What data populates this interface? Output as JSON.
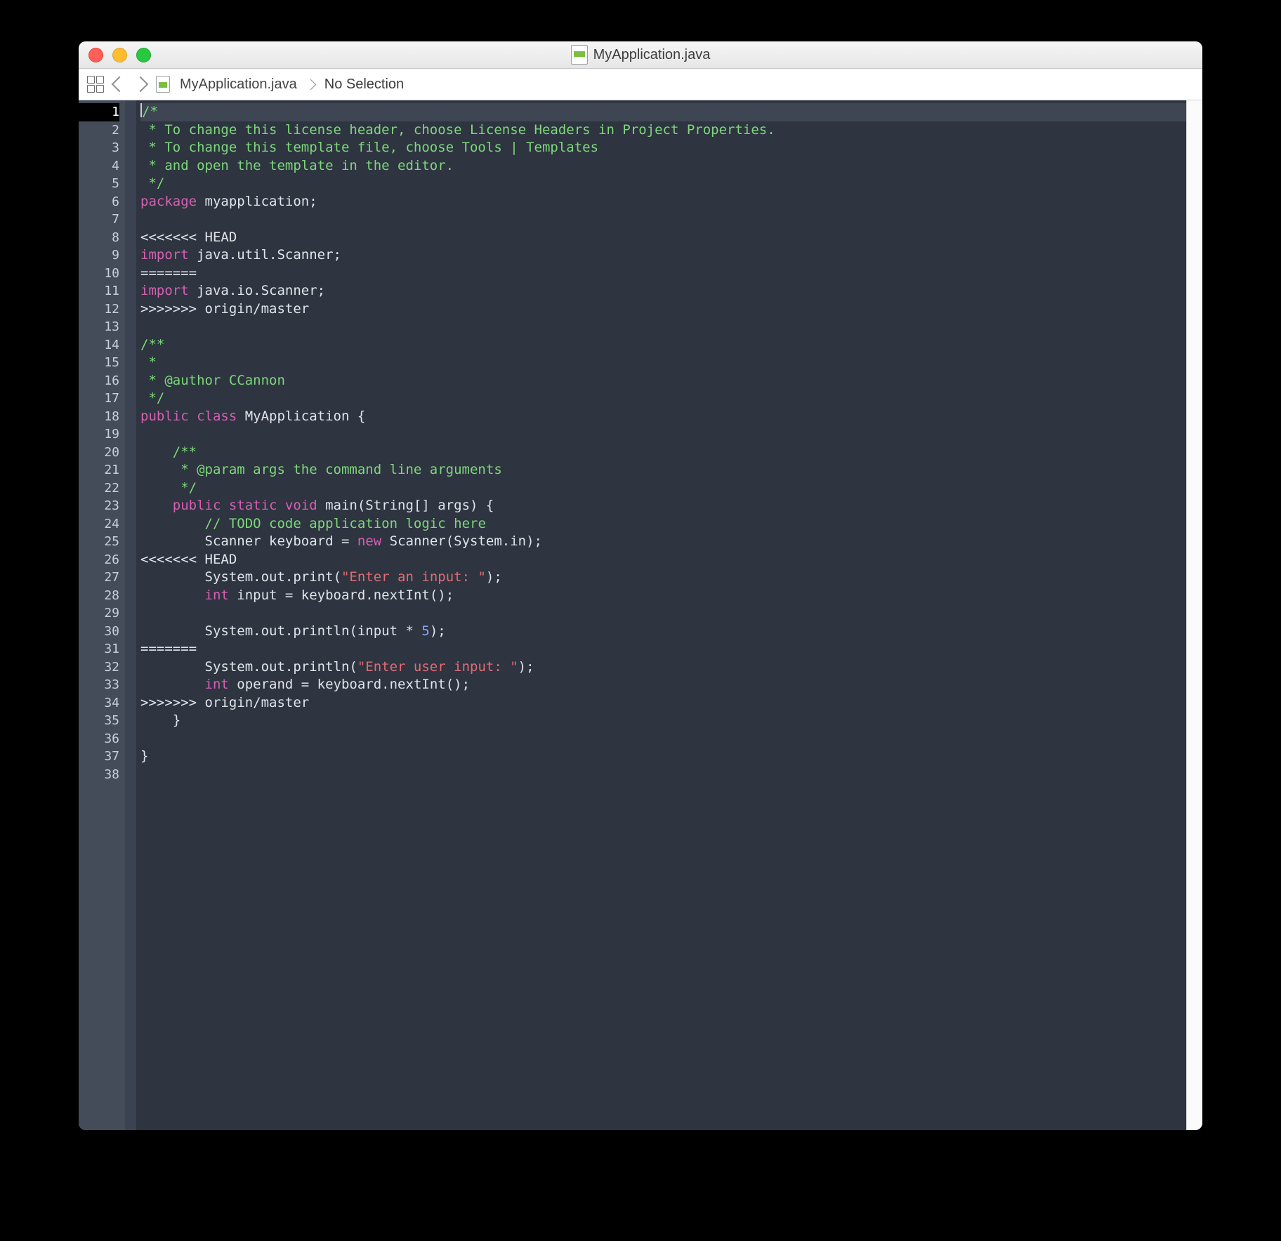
{
  "window": {
    "title": "MyApplication.java"
  },
  "pathbar": {
    "file": "MyApplication.java",
    "selection": "No Selection"
  },
  "gutter": {
    "total_lines": 38,
    "active_line": 1
  },
  "code": {
    "lines": [
      {
        "n": 1,
        "segs": [
          {
            "c": "c-comment",
            "t": "/*"
          }
        ],
        "active": true
      },
      {
        "n": 2,
        "segs": [
          {
            "c": "c-comment",
            "t": " * To change this license header, choose License Headers in Project Properties."
          }
        ]
      },
      {
        "n": 3,
        "segs": [
          {
            "c": "c-comment",
            "t": " * To change this template file, choose Tools | Templates"
          }
        ]
      },
      {
        "n": 4,
        "segs": [
          {
            "c": "c-comment",
            "t": " * and open the template in the editor."
          }
        ]
      },
      {
        "n": 5,
        "segs": [
          {
            "c": "c-comment",
            "t": " */"
          }
        ]
      },
      {
        "n": 6,
        "segs": [
          {
            "c": "c-keyword",
            "t": "package"
          },
          {
            "c": "c-plain",
            "t": " myapplication;"
          }
        ]
      },
      {
        "n": 7,
        "segs": [
          {
            "c": "c-plain",
            "t": ""
          }
        ]
      },
      {
        "n": 8,
        "segs": [
          {
            "c": "c-plain",
            "t": "<<<<<<< HEAD"
          }
        ]
      },
      {
        "n": 9,
        "segs": [
          {
            "c": "c-keyword",
            "t": "import"
          },
          {
            "c": "c-plain",
            "t": " java.util.Scanner;"
          }
        ]
      },
      {
        "n": 10,
        "segs": [
          {
            "c": "c-plain",
            "t": "======="
          }
        ]
      },
      {
        "n": 11,
        "segs": [
          {
            "c": "c-keyword",
            "t": "import"
          },
          {
            "c": "c-plain",
            "t": " java.io.Scanner;"
          }
        ]
      },
      {
        "n": 12,
        "segs": [
          {
            "c": "c-plain",
            "t": ">>>>>>> origin/master"
          }
        ]
      },
      {
        "n": 13,
        "segs": [
          {
            "c": "c-plain",
            "t": ""
          }
        ]
      },
      {
        "n": 14,
        "segs": [
          {
            "c": "c-comment",
            "t": "/**"
          }
        ]
      },
      {
        "n": 15,
        "segs": [
          {
            "c": "c-comment",
            "t": " *"
          }
        ]
      },
      {
        "n": 16,
        "segs": [
          {
            "c": "c-comment",
            "t": " * @author CCannon"
          }
        ]
      },
      {
        "n": 17,
        "segs": [
          {
            "c": "c-comment",
            "t": " */"
          }
        ]
      },
      {
        "n": 18,
        "segs": [
          {
            "c": "c-keyword",
            "t": "public class"
          },
          {
            "c": "c-plain",
            "t": " MyApplication {"
          }
        ]
      },
      {
        "n": 19,
        "segs": [
          {
            "c": "c-plain",
            "t": ""
          }
        ]
      },
      {
        "n": 20,
        "segs": [
          {
            "c": "c-comment",
            "t": "    /**"
          }
        ]
      },
      {
        "n": 21,
        "segs": [
          {
            "c": "c-comment",
            "t": "     * @param args the command line arguments"
          }
        ]
      },
      {
        "n": 22,
        "segs": [
          {
            "c": "c-comment",
            "t": "     */"
          }
        ]
      },
      {
        "n": 23,
        "segs": [
          {
            "c": "c-plain",
            "t": "    "
          },
          {
            "c": "c-keyword",
            "t": "public static void"
          },
          {
            "c": "c-plain",
            "t": " main(String[] args) {"
          }
        ]
      },
      {
        "n": 24,
        "segs": [
          {
            "c": "c-plain",
            "t": "        "
          },
          {
            "c": "c-todo",
            "t": "// TODO code application logic here"
          }
        ]
      },
      {
        "n": 25,
        "segs": [
          {
            "c": "c-plain",
            "t": "        Scanner keyboard = "
          },
          {
            "c": "c-keyword",
            "t": "new"
          },
          {
            "c": "c-plain",
            "t": " Scanner(System.in);"
          }
        ]
      },
      {
        "n": 26,
        "segs": [
          {
            "c": "c-plain",
            "t": "<<<<<<< HEAD"
          }
        ]
      },
      {
        "n": 27,
        "segs": [
          {
            "c": "c-plain",
            "t": "        System.out.print("
          },
          {
            "c": "c-string",
            "t": "\"Enter an input: \""
          },
          {
            "c": "c-plain",
            "t": ");"
          }
        ]
      },
      {
        "n": 28,
        "segs": [
          {
            "c": "c-plain",
            "t": "        "
          },
          {
            "c": "c-keyword",
            "t": "int"
          },
          {
            "c": "c-plain",
            "t": " input = keyboard.nextInt();"
          }
        ]
      },
      {
        "n": 29,
        "segs": [
          {
            "c": "c-plain",
            "t": ""
          }
        ]
      },
      {
        "n": 30,
        "segs": [
          {
            "c": "c-plain",
            "t": "        System.out.println(input * "
          },
          {
            "c": "c-number",
            "t": "5"
          },
          {
            "c": "c-plain",
            "t": ");"
          }
        ]
      },
      {
        "n": 31,
        "segs": [
          {
            "c": "c-plain",
            "t": "======="
          }
        ]
      },
      {
        "n": 32,
        "segs": [
          {
            "c": "c-plain",
            "t": "        System.out.println("
          },
          {
            "c": "c-string",
            "t": "\"Enter user input: \""
          },
          {
            "c": "c-plain",
            "t": ");"
          }
        ]
      },
      {
        "n": 33,
        "segs": [
          {
            "c": "c-plain",
            "t": "        "
          },
          {
            "c": "c-keyword",
            "t": "int"
          },
          {
            "c": "c-plain",
            "t": " operand = keyboard.nextInt();"
          }
        ]
      },
      {
        "n": 34,
        "segs": [
          {
            "c": "c-plain",
            "t": ">>>>>>> origin/master"
          }
        ]
      },
      {
        "n": 35,
        "segs": [
          {
            "c": "c-plain",
            "t": "    }"
          }
        ]
      },
      {
        "n": 36,
        "segs": [
          {
            "c": "c-plain",
            "t": ""
          }
        ]
      },
      {
        "n": 37,
        "segs": [
          {
            "c": "c-plain",
            "t": "}"
          }
        ]
      },
      {
        "n": 38,
        "segs": [
          {
            "c": "c-plain",
            "t": ""
          }
        ]
      }
    ]
  }
}
